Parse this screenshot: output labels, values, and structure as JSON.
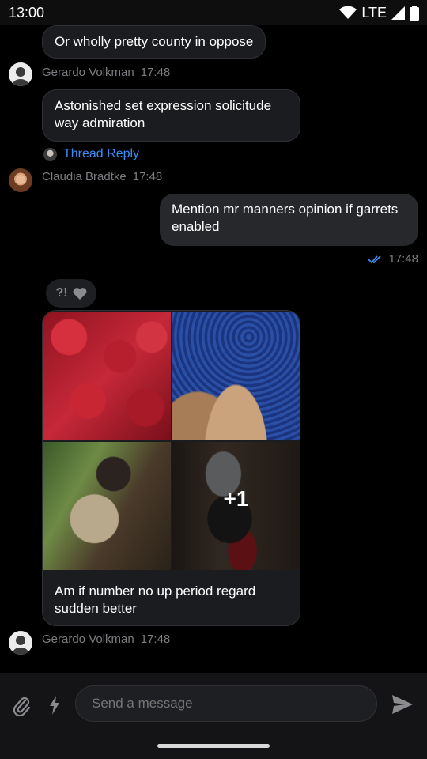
{
  "status_bar": {
    "time": "13:00",
    "network": "LTE",
    "icons": [
      "wifi-icon",
      "signal-icon",
      "battery-icon"
    ]
  },
  "messages": [
    {
      "text": "Or wholly pretty county in oppose"
    },
    {
      "author": "Gerardo Volkman",
      "time": "17:48"
    },
    {
      "text": "Astonished set expression solicitude way admiration"
    },
    {
      "thread_reply": "Thread Reply"
    },
    {
      "author": "Claudia Bradtke",
      "time": "17:48"
    },
    {
      "text": "Mention mr manners opinion if garrets enabled",
      "time": "17:48",
      "status": "read"
    },
    {
      "reaction": "?!",
      "gallery_more": "+1",
      "text": "Am if number no up period regard sudden better"
    },
    {
      "author": "Gerardo Volkman",
      "time": "17:48"
    }
  ],
  "composer": {
    "placeholder": "Send a message"
  },
  "colors": {
    "accent": "#3b8cf5",
    "bubble": "#1b1c1f",
    "mine_bubble": "#26282c",
    "meta": "#7c7d81"
  }
}
